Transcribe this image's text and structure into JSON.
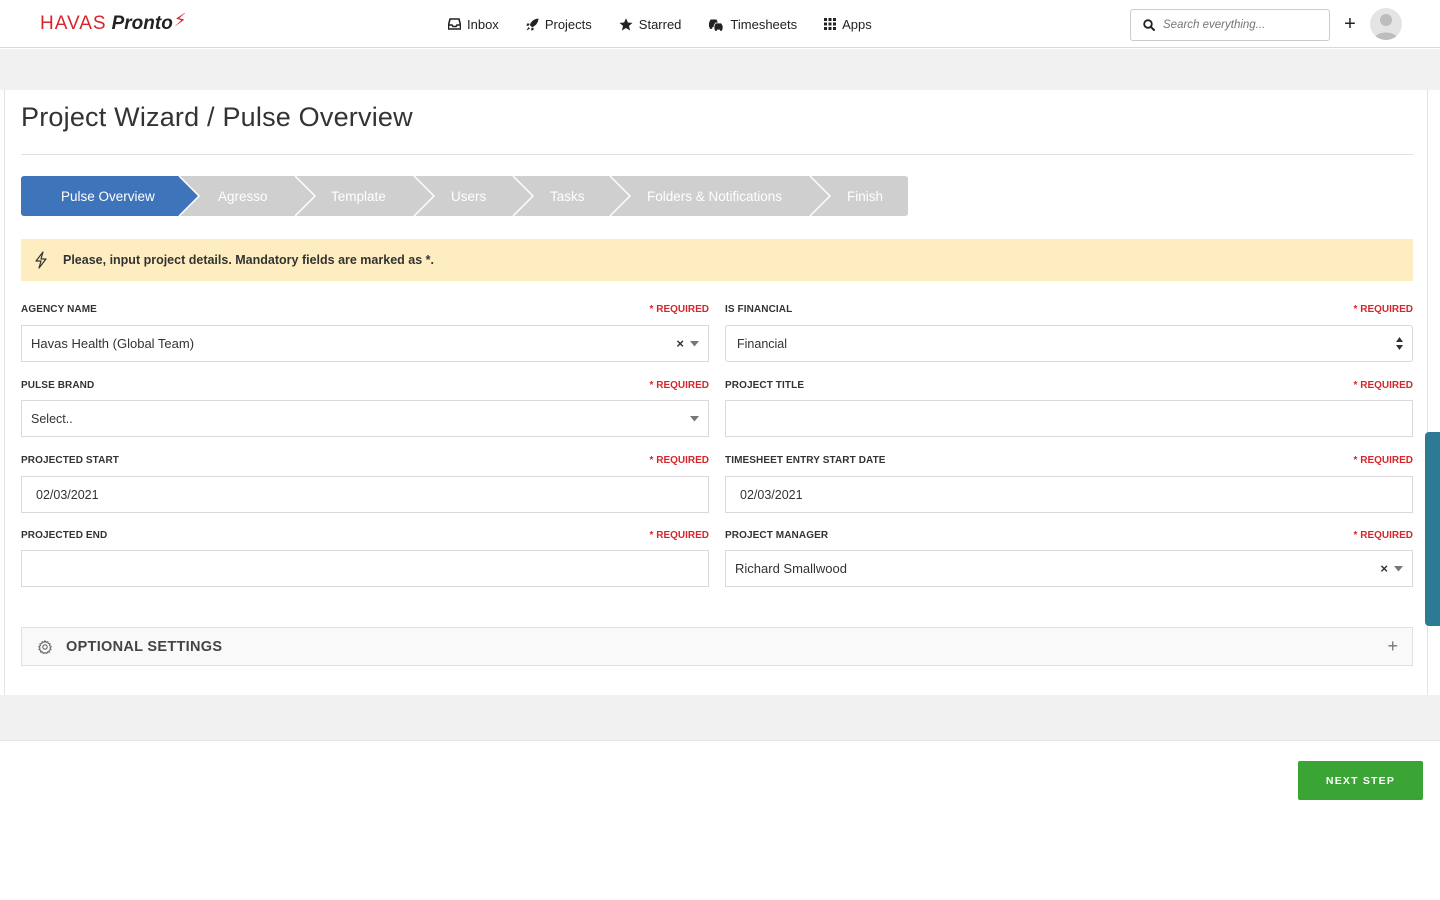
{
  "header": {
    "logo_havas": "HAVAS",
    "logo_pronto": "Pronto",
    "logo_bolt": "⚡",
    "nav": [
      {
        "label": "Inbox",
        "icon": "inbox-icon"
      },
      {
        "label": "Projects",
        "icon": "rocket-icon"
      },
      {
        "label": "Starred",
        "icon": "star-icon"
      },
      {
        "label": "Timesheets",
        "icon": "cars-icon"
      },
      {
        "label": "Apps",
        "icon": "grid-icon"
      }
    ],
    "search_placeholder": "Search everything...",
    "add_label": "+"
  },
  "page": {
    "title": "Project Wizard / Pulse Overview"
  },
  "wizard": {
    "steps": [
      {
        "label": "Pulse Overview",
        "active": true
      },
      {
        "label": "Agresso",
        "active": false
      },
      {
        "label": "Template",
        "active": false
      },
      {
        "label": "Users",
        "active": false
      },
      {
        "label": "Tasks",
        "active": false
      },
      {
        "label": "Folders & Notifications",
        "active": false
      },
      {
        "label": "Finish",
        "active": false
      }
    ]
  },
  "alert": {
    "text": "Please, input project details. Mandatory fields are marked as *."
  },
  "form": {
    "required_text": "* REQUIRED",
    "agency_name": {
      "label": "AGENCY NAME",
      "value": "Havas Health (Global Team)"
    },
    "is_financial": {
      "label": "IS FINANCIAL",
      "value": "Financial"
    },
    "pulse_brand": {
      "label": "PULSE BRAND",
      "value": "Select.."
    },
    "project_title": {
      "label": "PROJECT TITLE",
      "value": ""
    },
    "projected_start": {
      "label": "PROJECTED START",
      "value": "02/03/2021"
    },
    "timesheet_start": {
      "label": "TIMESHEET ENTRY START DATE",
      "value": "02/03/2021"
    },
    "projected_end": {
      "label": "PROJECTED END",
      "value": ""
    },
    "project_manager": {
      "label": "PROJECT MANAGER",
      "value": "Richard Smallwood"
    }
  },
  "optional_settings": {
    "label": "OPTIONAL SETTINGS",
    "expand": "+"
  },
  "footer": {
    "next_label": "NEXT STEP"
  },
  "colors": {
    "brand_red": "#d6262b",
    "step_active": "#3e75ba",
    "step_inactive": "#cfcfcf",
    "alert_bg": "#fdedc0",
    "next_green": "#3aa534"
  }
}
